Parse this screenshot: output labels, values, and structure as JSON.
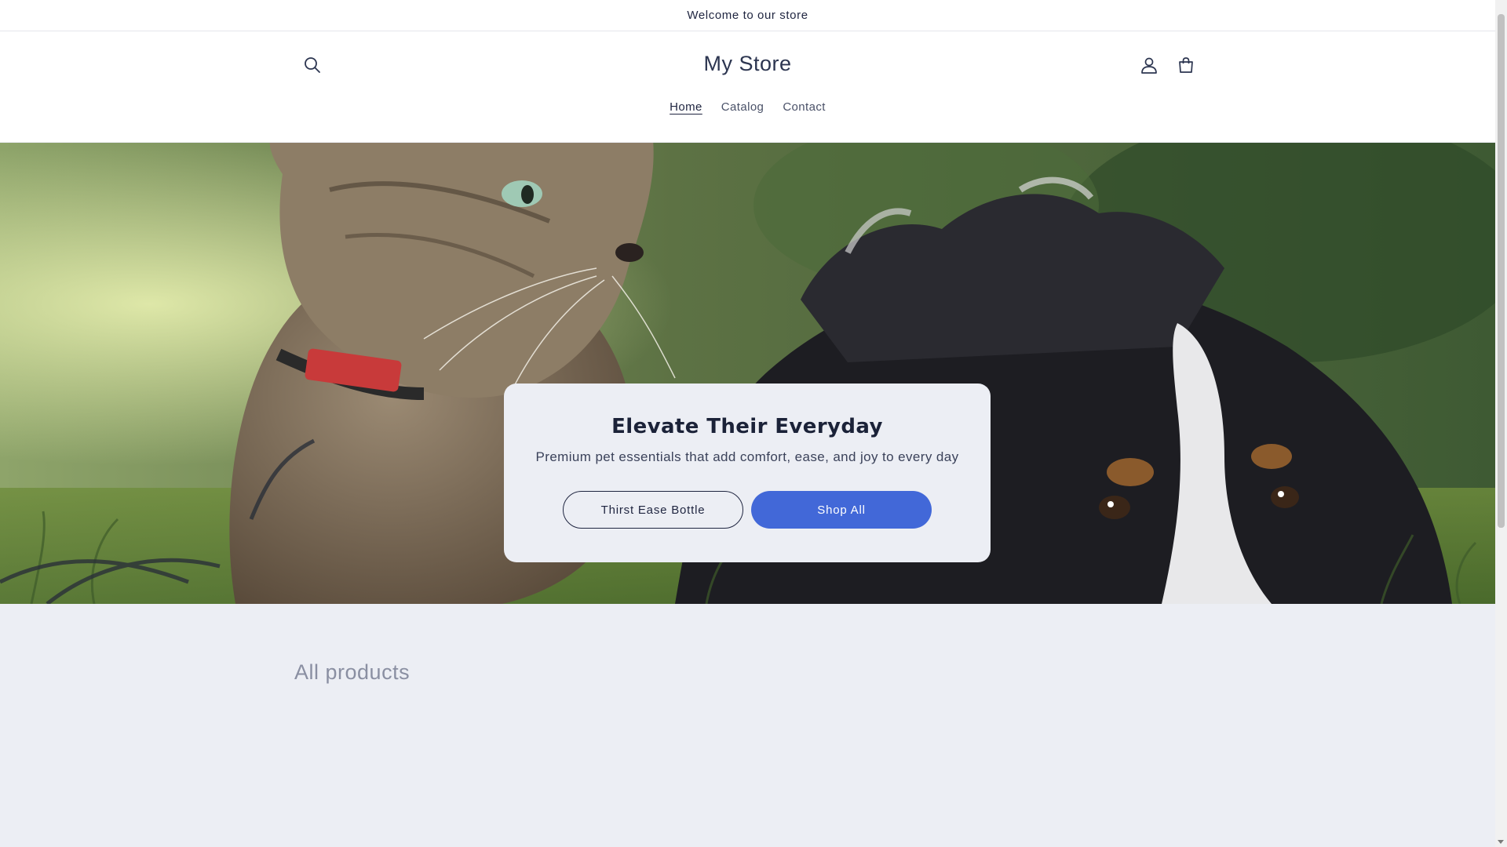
{
  "announcement": {
    "text": "Welcome to our store"
  },
  "header": {
    "store_name": "My Store",
    "nav": [
      {
        "label": "Home",
        "active": true
      },
      {
        "label": "Catalog",
        "active": false
      },
      {
        "label": "Contact",
        "active": false
      }
    ],
    "icons": {
      "search": "search-icon",
      "account": "account-icon",
      "cart": "cart-icon"
    }
  },
  "hero": {
    "title": "Elevate Their Everyday",
    "subtitle": "Premium pet essentials that add comfort, ease, and joy to every day",
    "buttons": {
      "primary_outline": "Thirst Ease Bottle",
      "primary_solid": "Shop All"
    }
  },
  "products": {
    "title": "All products"
  },
  "colors": {
    "accent": "#4268d8",
    "text_dark": "#1f2540",
    "background": "#eceef4"
  }
}
